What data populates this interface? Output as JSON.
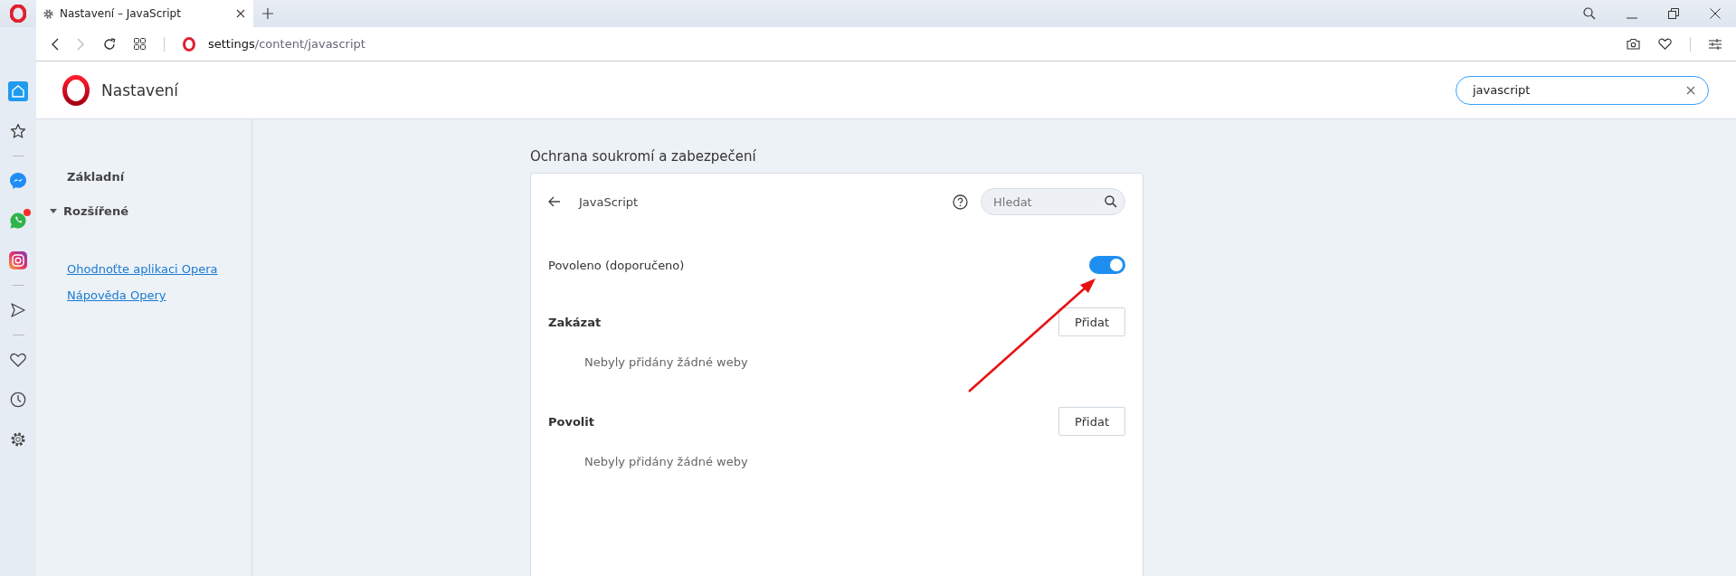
{
  "tabs": [
    {
      "title": "Nastavení – JavaScript",
      "selected": true
    }
  ],
  "address_bar": {
    "host": "settings",
    "path": "/content/javascript"
  },
  "sidebar": {
    "items": [
      {
        "kind": "home",
        "selected": true,
        "badge": false
      },
      {
        "kind": "star",
        "selected": false,
        "badge": false
      },
      {
        "kind": "divider"
      },
      {
        "kind": "messenger",
        "selected": false,
        "badge": false
      },
      {
        "kind": "whatsapp",
        "selected": false,
        "badge": true
      },
      {
        "kind": "instagram",
        "selected": false,
        "badge": false
      },
      {
        "kind": "divider"
      },
      {
        "kind": "send",
        "selected": false,
        "badge": false
      },
      {
        "kind": "divider"
      },
      {
        "kind": "heart",
        "selected": false,
        "badge": false
      },
      {
        "kind": "clock",
        "selected": false,
        "badge": false
      },
      {
        "kind": "gear",
        "selected": false,
        "badge": false
      }
    ]
  },
  "settings_header": {
    "title": "Nastavení",
    "search": {
      "value": "javascript"
    }
  },
  "settings_nav": {
    "sections": [
      {
        "label": "Základní",
        "expanded": false
      },
      {
        "label": "Rozšířené",
        "expanded": true
      }
    ],
    "links": [
      "Ohodnoťte aplikaci Opera",
      "Nápověda Opery"
    ]
  },
  "section_title": "Ochrana soukromí a zabezpečení",
  "card": {
    "title": "JavaScript",
    "search": {
      "placeholder": "Hledat"
    },
    "toggle": {
      "label": "Povoleno (doporučeno)",
      "on": true
    },
    "lists": [
      {
        "title": "Zakázat",
        "button": "Přidat",
        "empty": "Nebyly přidány žádné weby"
      },
      {
        "title": "Povolit",
        "button": "Přidat",
        "empty": "Nebyly přidány žádné weby"
      }
    ]
  }
}
